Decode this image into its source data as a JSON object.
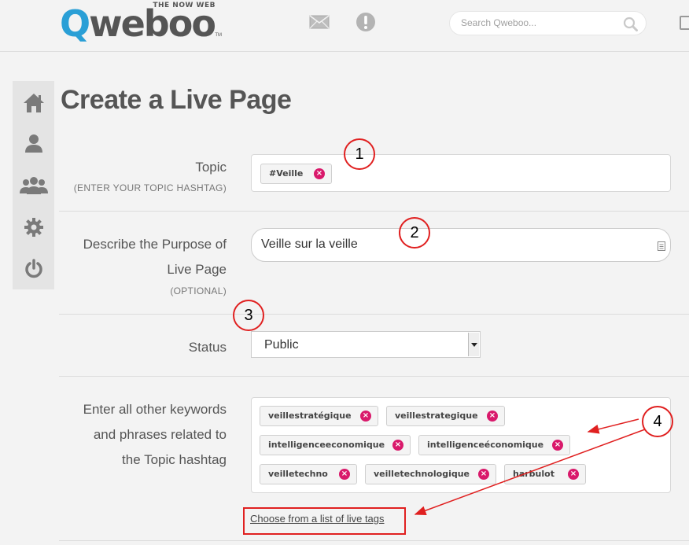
{
  "header": {
    "logo_tagline": "THE NOW WEB",
    "logo_q": "Q",
    "logo_rest": "weboo",
    "logo_tm": "TM",
    "mail_icon": "envelope-icon",
    "alert_icon": "exclamation-circle-icon",
    "search_placeholder": "Search Qweboo...",
    "search_icon": "magnifier-icon"
  },
  "sidebar": {
    "items": [
      {
        "icon": "home-icon"
      },
      {
        "icon": "user-icon"
      },
      {
        "icon": "users-icon"
      },
      {
        "icon": "gear-icon"
      },
      {
        "icon": "power-icon"
      }
    ]
  },
  "page": {
    "title": "Create a Live Page"
  },
  "form": {
    "topic": {
      "label": "Topic",
      "sublabel": "(ENTER YOUR TOPIC HASHTAG)",
      "tags": [
        "#Veille"
      ]
    },
    "purpose": {
      "label_line1": "Describe the Purpose of",
      "label_line2": "Live Page",
      "sublabel": "(OPTIONAL)",
      "value": "Veille sur la veille"
    },
    "status": {
      "label": "Status",
      "value": "Public"
    },
    "keywords": {
      "label_line1": "Enter all other keywords",
      "label_line2": "and phrases related to",
      "label_line3": "the Topic hashtag",
      "tags": [
        "veillestratégique",
        "veillestrategique",
        "intelligenceeconomique",
        "intelligenceéconomique",
        "veilletechno",
        "veilletechnologique",
        "harbulot"
      ]
    },
    "live_tags_link": "Choose from a list of live tags"
  },
  "annotations": {
    "markers": [
      "1",
      "2",
      "3",
      "4"
    ],
    "color": "#e02020"
  },
  "colors": {
    "brand_blue": "#2a9fd6",
    "tag_remove": "#d9196b"
  }
}
